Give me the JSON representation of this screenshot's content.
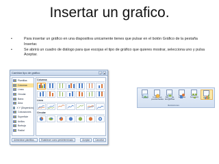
{
  "page": {
    "title": "Insertar un grafico.",
    "bullets": [
      {
        "marker": "•",
        "text": "Para insertar un gráfico en una diapositiva unicamente tienes que pulsar en el botón Gráfico de la pestaña Insertar."
      },
      {
        "marker": "•",
        "text": "Se abrirá un cuadro de diálogo para que escojas el tipo de gráfico que quieres mostrar, selecciona uno y pulsa Aceptar."
      }
    ]
  },
  "dialog": {
    "title": "Cambiar tipo de gráfico",
    "help_glyph": "?",
    "close_glyph": "✕",
    "categories": [
      {
        "label": "Plantillas",
        "selected": false
      },
      {
        "label": "Columna",
        "selected": true
      },
      {
        "label": "Línea",
        "selected": false
      },
      {
        "label": "Circular",
        "selected": false
      },
      {
        "label": "Barra",
        "selected": false
      },
      {
        "label": "Área",
        "selected": false
      },
      {
        "label": "X Y (Dispersión)",
        "selected": false
      },
      {
        "label": "Cotizaciones",
        "selected": false
      },
      {
        "label": "Superficie",
        "selected": false
      },
      {
        "label": "Anillos",
        "selected": false
      },
      {
        "label": "Burbuja",
        "selected": false
      },
      {
        "label": "Radial",
        "selected": false
      }
    ],
    "sections": {
      "column": "Columna",
      "line": "Línea",
      "pie": "Circular"
    },
    "buttons": {
      "manage_templates": "Administrar plantillas...",
      "set_default": "Establecer como predeterminado",
      "ok": "Aceptar",
      "cancel": "Cancelar"
    }
  },
  "ribbon": {
    "items": [
      {
        "label": "Imagen",
        "icon": "picture-icon"
      },
      {
        "label": "Imágenes prediseñadas",
        "icon": "clipart-icon"
      },
      {
        "label": "Álbum de fotografías",
        "icon": "photo-album-icon"
      },
      {
        "label": "Formas",
        "icon": "shapes-icon"
      },
      {
        "label": "SmartArt",
        "icon": "smartart-icon"
      },
      {
        "label": "Gráfico",
        "icon": "chart-icon",
        "selected": true
      }
    ],
    "group_label": "Ilustraciones"
  }
}
